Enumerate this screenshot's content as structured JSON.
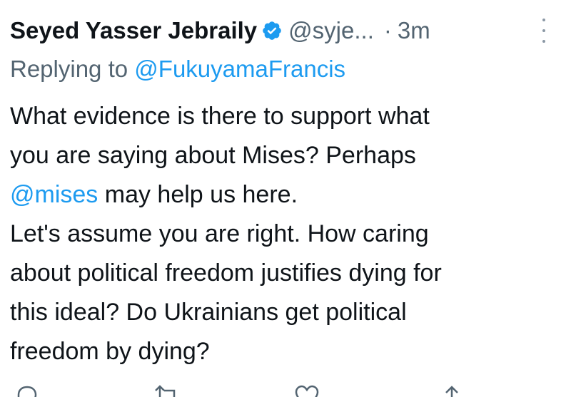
{
  "tweet": {
    "author_name": "Seyed Yasser Jebraily",
    "author_handle": "@syje...",
    "separator": "·",
    "time": "3m",
    "replying_prefix": "Replying to",
    "replying_handle": "@FukuyamaFrancis",
    "line1": "What evidence is there to support what",
    "line2": "you are saying about Mises? Perhaps",
    "line3_mention": "@mises",
    "line3_rest": " may help us here.",
    "line4": "Let's assume you are right. How caring",
    "line5": "about political freedom justifies dying for",
    "line6": "this ideal? Do Ukrainians get political",
    "line7": "freedom by dying?"
  },
  "icons": {
    "verified": "verified-badge-icon",
    "more": "more-vertical-icon",
    "reply": "reply-icon",
    "retweet": "retweet-icon",
    "like": "heart-icon",
    "share": "share-icon"
  },
  "colors": {
    "text": "#0f1419",
    "muted": "#536471",
    "link": "#1d9bf0",
    "verified": "#1d9bf0"
  }
}
